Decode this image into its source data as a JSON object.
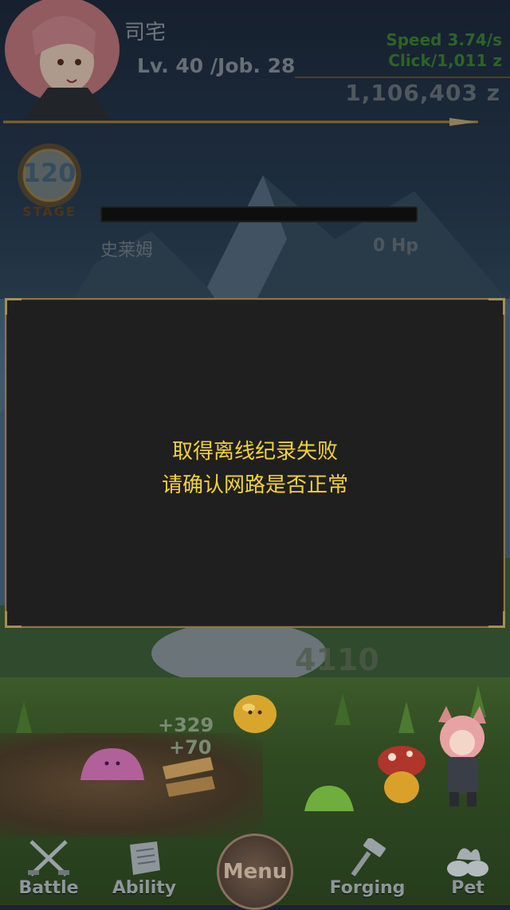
{
  "player": {
    "name": "司宅",
    "level_text": "Lv. 40 /Job. 28",
    "speed_text": "Speed 3.74/s",
    "click_text": "Click/1,011 z",
    "zeny_text": "1,106,403 z"
  },
  "stage": {
    "number": "120",
    "label": "STAGE"
  },
  "monster": {
    "name": "史莱姆",
    "hp_text": "0 Hp",
    "hp_fraction": 0
  },
  "dialog": {
    "line1": "取得离线纪录失败",
    "line2": "请确认网路是否正常"
  },
  "battle": {
    "damage": "4110",
    "gain1": "+329",
    "gain2": "+70"
  },
  "nav": {
    "battle": "Battle",
    "ability": "Ability",
    "menu": "Menu",
    "forging": "Forging",
    "pet": "Pet"
  },
  "colors": {
    "dialog_text": "#f2d33b",
    "dialog_bg": "#1f1f1f",
    "dialog_border": "#8c7548",
    "speed_green": "#3f8a3a"
  }
}
